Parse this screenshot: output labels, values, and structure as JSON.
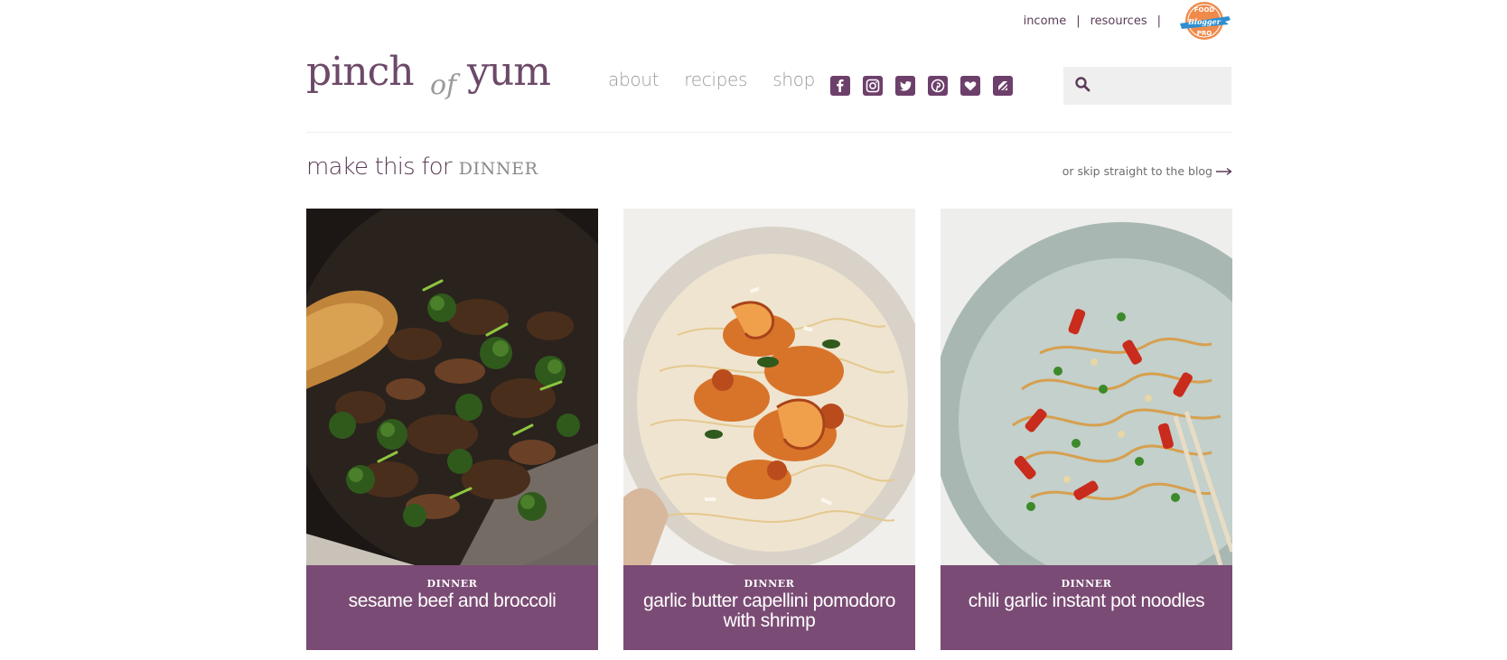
{
  "utility": {
    "links": [
      {
        "label": "income"
      },
      {
        "label": "resources"
      }
    ],
    "separator": "|",
    "badge": {
      "line1": "FOOD",
      "line2": "Blogger",
      "line3": "PRO"
    }
  },
  "logo": {
    "part1": "pinch",
    "part2": "of",
    "part3": "yum"
  },
  "nav": {
    "items": [
      {
        "label": "about"
      },
      {
        "label": "recipes"
      },
      {
        "label": "shop"
      }
    ]
  },
  "social": {
    "icons": [
      "facebook-icon",
      "instagram-icon",
      "twitter-icon",
      "pinterest-icon",
      "bloglovin-icon",
      "feedly-icon"
    ]
  },
  "search": {
    "placeholder": ""
  },
  "section": {
    "lead": "make this for",
    "category": "DINNER",
    "skip_label": "or skip straight to the blog"
  },
  "cards": [
    {
      "kicker": "DINNER",
      "title": "sesame beef and broccoli"
    },
    {
      "kicker": "DINNER",
      "title": "garlic butter capellini pomodoro with shrimp"
    },
    {
      "kicker": "DINNER",
      "title": "chili garlic instant pot noodles"
    }
  ],
  "colors": {
    "brand_purple": "#5b3b58",
    "caption_bg": "#7a4b74",
    "nav_grey": "#9a9a9a",
    "search_bg": "#efefef"
  }
}
